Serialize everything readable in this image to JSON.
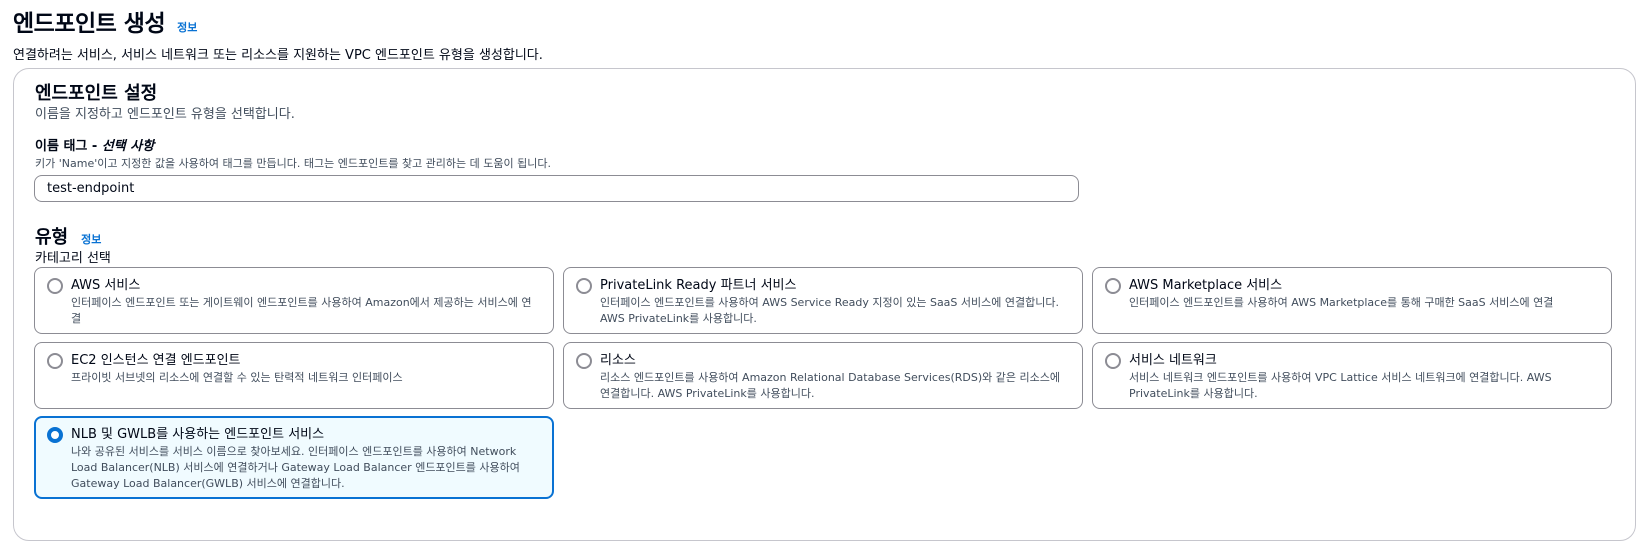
{
  "header": {
    "title": "엔드포인트 생성",
    "info": "정보",
    "description": "연결하려는 서비스, 서비스 네트워크 또는 리소스를 지원하는 VPC 엔드포인트 유형을 생성합니다."
  },
  "settings": {
    "title": "엔드포인트 설정",
    "description": "이름을 지정하고 엔드포인트 유형을 선택합니다.",
    "name_tag_label": "이름 태그 - ",
    "name_tag_optional": "선택 사항",
    "name_tag_hint": "키가 'Name'이고 지정한 값을 사용하여 태그를 만듭니다. 태그는 엔드포인트를 찾고 관리하는 데 도움이 됩니다.",
    "name_tag_value": "test-endpoint"
  },
  "type": {
    "title": "유형",
    "info": "정보",
    "subtitle": "카테고리 선택",
    "selected": "nlb-gwlb",
    "options": [
      {
        "title": "AWS 서비스",
        "description": "인터페이스 엔드포인트 또는 게이트웨이 엔드포인트를 사용하여 Amazon에서 제공하는 서비스에 연결"
      },
      {
        "title": "PrivateLink Ready 파트너 서비스",
        "description": "인터페이스 엔드포인트를 사용하여 AWS Service Ready 지정이 있는 SaaS 서비스에 연결합니다. AWS PrivateLink를 사용합니다."
      },
      {
        "title": "AWS Marketplace 서비스",
        "description": "인터페이스 엔드포인트를 사용하여 AWS Marketplace를 통해 구매한 SaaS 서비스에 연결"
      },
      {
        "title": "EC2 인스턴스 연결 엔드포인트",
        "description": "프라이빗 서브넷의 리소스에 연결할 수 있는 탄력적 네트워크 인터페이스"
      },
      {
        "title": "리소스",
        "description": "리소스 엔드포인트를 사용하여 Amazon Relational Database Services(RDS)와 같은 리소스에 연결합니다. AWS PrivateLink를 사용합니다."
      },
      {
        "title": "서비스 네트워크",
        "description": "서비스 네트워크 엔드포인트를 사용하여 VPC Lattice 서비스 네트워크에 연결합니다. AWS PrivateLink를 사용합니다."
      },
      {
        "title": "NLB 및 GWLB를 사용하는 엔드포인트 서비스",
        "description": "나와 공유된 서비스를 서비스 이름으로 찾아보세요. 인터페이스 엔드포인트를 사용하여 Network Load Balancer(NLB) 서비스에 연결하거나 Gateway Load Balancer 엔드포인트를 사용하여 Gateway Load Balancer(GWLB) 서비스에 연결합니다."
      }
    ]
  }
}
